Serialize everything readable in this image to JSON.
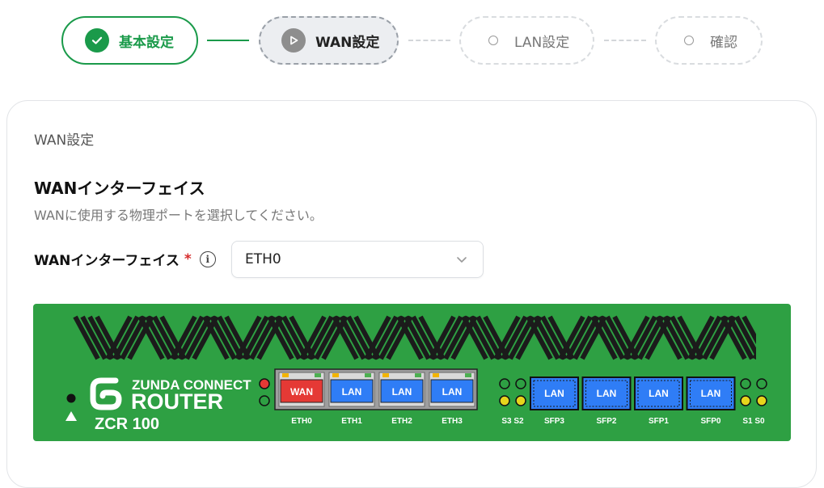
{
  "stepper": {
    "steps": [
      {
        "label": "基本設定",
        "state": "done"
      },
      {
        "label": "WAN設定",
        "state": "active"
      },
      {
        "label": "LAN設定",
        "state": "pending"
      },
      {
        "label": "確認",
        "state": "pending"
      }
    ]
  },
  "card": {
    "title": "WAN設定",
    "section_title": "WANインターフェイス",
    "section_desc": "WANに使用する物理ポートを選択してください。",
    "field_label": "WANインターフェイス",
    "required_mark": "*",
    "info_glyph": "i",
    "select_value": "ETH0"
  },
  "router": {
    "brand_line1": "ZUNDA CONNECT",
    "brand_line2": "ROUTER",
    "model": "ZCR 100",
    "eth_ports": [
      {
        "name": "ETH0",
        "role": "WAN",
        "color": "#e53935"
      },
      {
        "name": "ETH1",
        "role": "LAN",
        "color": "#2f7df6"
      },
      {
        "name": "ETH2",
        "role": "LAN",
        "color": "#2f7df6"
      },
      {
        "name": "ETH3",
        "role": "LAN",
        "color": "#2f7df6"
      }
    ],
    "sfp_ports": [
      {
        "name": "SFP3",
        "role": "LAN"
      },
      {
        "name": "SFP2",
        "role": "LAN"
      },
      {
        "name": "SFP1",
        "role": "LAN"
      },
      {
        "name": "SFP0",
        "role": "LAN"
      }
    ],
    "led_left_labels": "S3 S2",
    "led_right_labels": "S1 S0",
    "colors": {
      "body": "#2ea043",
      "accent": "#1a9a4a",
      "lan": "#2f7df6",
      "wan": "#e53935"
    }
  }
}
